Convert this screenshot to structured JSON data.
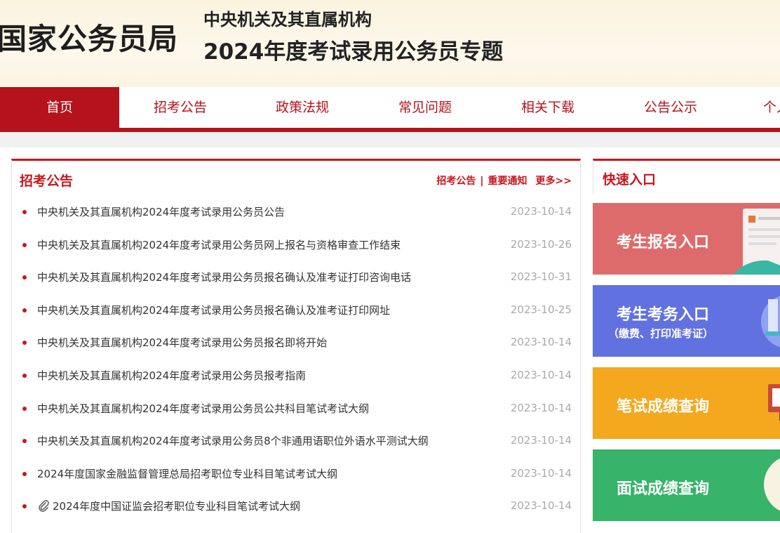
{
  "header": {
    "site_name": "国家公务员局",
    "sub_title": "中央机关及其直属机构",
    "main_title": "2024年度考试录用公务员专题"
  },
  "nav": {
    "items": [
      {
        "label": "首页",
        "active": true
      },
      {
        "label": "招考公告",
        "active": false
      },
      {
        "label": "政策法规",
        "active": false
      },
      {
        "label": "常见问题",
        "active": false
      },
      {
        "label": "相关下载",
        "active": false
      },
      {
        "label": "公告公示",
        "active": false
      },
      {
        "label": "个人",
        "active": false
      }
    ]
  },
  "announcements": {
    "title": "招考公告",
    "link_1": "招考公告",
    "separator": "|",
    "link_2": "重要通知",
    "more": "更多>>",
    "items": [
      {
        "title": "中央机关及其直属机构2024年度考试录用公务员公告",
        "date": "2023-10-14"
      },
      {
        "title": "中央机关及其直属机构2024年度考试录用公务员网上报名与资格审查工作结束",
        "date": "2023-10-26"
      },
      {
        "title": "中央机关及其直属机构2024年度考试录用公务员报名确认及准考证打印咨询电话",
        "date": "2023-10-31"
      },
      {
        "title": "中央机关及其直属机构2024年度考试录用公务员报名确认及准考证打印网址",
        "date": "2023-10-25"
      },
      {
        "title": "中央机关及其直属机构2024年度考试录用公务员报名即将开始",
        "date": "2023-10-14"
      },
      {
        "title": "中央机关及其直属机构2024年度考试录用公务员报考指南",
        "date": "2023-10-14"
      },
      {
        "title": "中央机关及其直属机构2024年度考试录用公务员公共科目笔试考试大纲",
        "date": "2023-10-14"
      },
      {
        "title": "中央机关及其直属机构2024年度考试录用公务员8个非通用语职位外语水平测试大纲",
        "date": "2023-10-14"
      },
      {
        "title": "2024年度国家金融监督管理总局招考职位专业科目笔试考试大纲",
        "date": "2023-10-14"
      },
      {
        "title": "2024年度中国证监会招考职位专业科目笔试考试大纲",
        "date": "2023-10-14",
        "icon": "paperclip-icon"
      }
    ]
  },
  "quick_entry": {
    "title": "快速入口",
    "buttons": [
      {
        "label": "考生报名入口",
        "color": "#de6b6b",
        "icon": "form-document-icon"
      },
      {
        "label": "考生考务入口",
        "sub": "（缴费、打印准考证）",
        "color": "#6171e0",
        "icon": "laptop-icon"
      },
      {
        "label": "笔试成绩查询",
        "color": "#f4a81d",
        "icon": "monitor-icon"
      },
      {
        "label": "面试成绩查询",
        "color": "#37b36a",
        "icon": "person-icon"
      }
    ]
  },
  "colors": {
    "brand_red": "#b5121b",
    "header_bg": "#fbf3df",
    "date_gray": "#aaaaaa"
  }
}
